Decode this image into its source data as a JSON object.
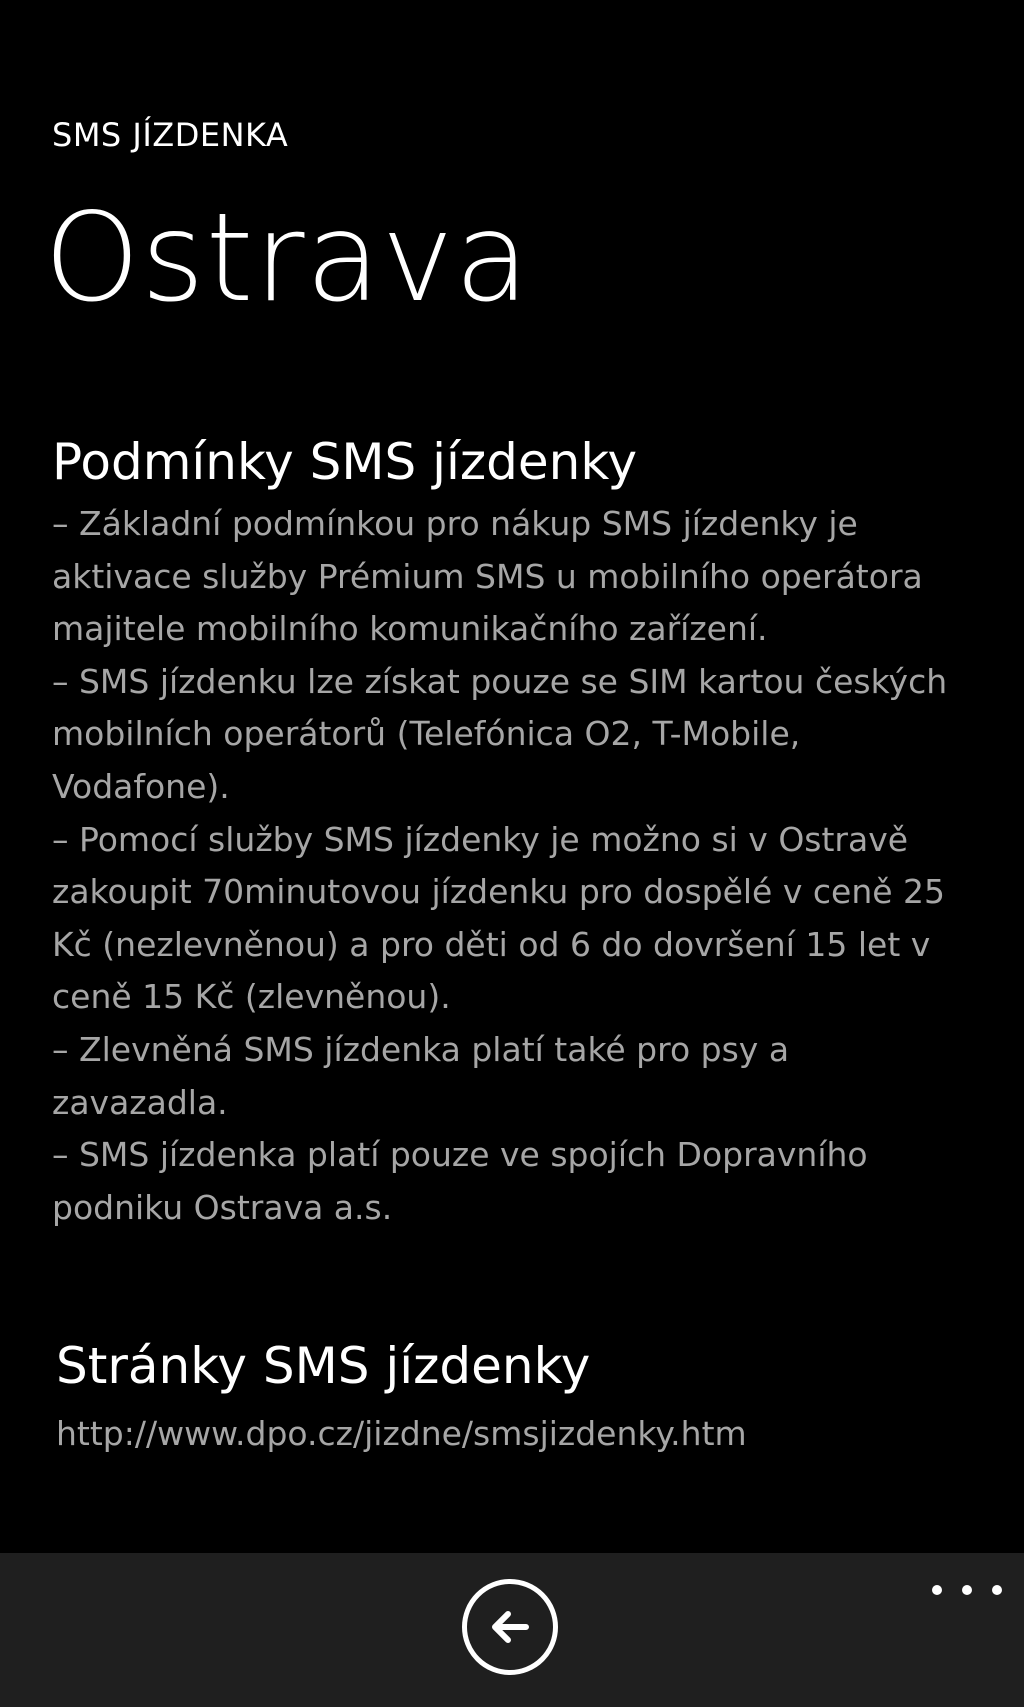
{
  "app": {
    "title": "SMS JÍZDENKA"
  },
  "page": {
    "title": "Ostrava"
  },
  "terms": {
    "heading": "Podmínky SMS jízdenky",
    "paragraphs": [
      "– Základní podmínkou pro nákup SMS jízdenky je aktivace služby Prémium SMS u mobilního operátora majitele mobilního komunikačního zařízení.",
      "– SMS jízdenku lze získat pouze se SIM kartou českých mobilních operátorů (Telefónica O2, T-Mobile, Vodafone).",
      "– Pomocí služby SMS jízdenky je možno si v Ostravě zakoupit 70minutovou jízdenku pro dospělé v ceně 25 Kč (nezlevněnou) a pro děti od 6 do dovršení 15 let v ceně 15 Kč (zlevněnou).",
      "– Zlevněná SMS jízdenka platí také pro psy a zavazadla.",
      "– SMS jízdenka platí pouze ve spojích Dopravního podniku Ostrava a.s."
    ]
  },
  "links": {
    "heading": "Stránky SMS jízdenky",
    "url": "http://www.dpo.cz/jizdne/smsjizdenky.htm"
  },
  "app_bar": {
    "back_icon": "arrow-left-icon",
    "more_icon": "ellipsis-icon"
  },
  "colors": {
    "background": "#000000",
    "foreground": "#ffffff",
    "secondary_text": "#a6a6a6",
    "app_bar": "#1f1f1f"
  }
}
